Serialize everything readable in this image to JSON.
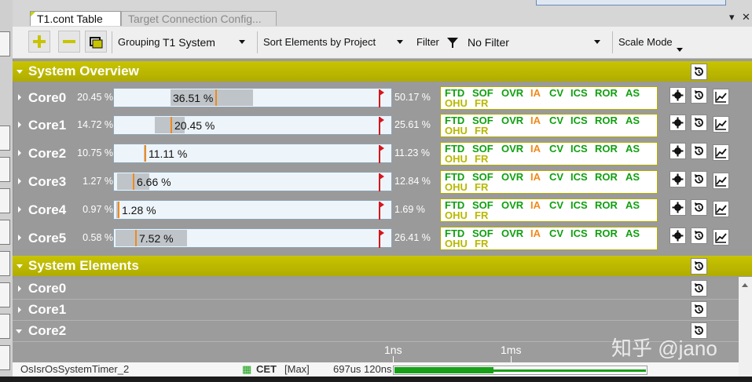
{
  "tabs": [
    {
      "label": "T1.cont Table",
      "active": true
    },
    {
      "label": "Target Connection Config...",
      "active": false
    }
  ],
  "toolbar": {
    "grouping_label": "Grouping",
    "grouping_value": "T1 System",
    "sort_value": "Sort Elements by Project",
    "filter_label": "Filter",
    "filter_value": "No Filter",
    "scale_mode_label": "Scale Mode"
  },
  "system_overview": {
    "title": "System Overview",
    "cores": [
      {
        "name": "Core0",
        "min": "20.45 %",
        "avg": 36.51,
        "avg_text": "36.51 %",
        "max": 50.17,
        "max_text": "50.17 %"
      },
      {
        "name": "Core1",
        "min": "14.72 %",
        "avg": 20.45,
        "avg_text": "20.45 %",
        "max": 25.61,
        "max_text": "25.61 %"
      },
      {
        "name": "Core2",
        "min": "10.75 %",
        "avg": 11.11,
        "avg_text": "11.11 %",
        "max": 11.23,
        "max_text": "11.23 %"
      },
      {
        "name": "Core3",
        "min": "1.27 %",
        "avg": 6.66,
        "avg_text": "6.66 %",
        "max": 12.84,
        "max_text": "12.84 %"
      },
      {
        "name": "Core4",
        "min": "0.97 %",
        "avg": 1.28,
        "avg_text": "1.28 %",
        "max": 1.69,
        "max_text": "1.69 %"
      },
      {
        "name": "Core5",
        "min": "0.58 %",
        "avg": 7.52,
        "avg_text": "7.52 %",
        "max": 26.41,
        "max_text": "26.41 %"
      }
    ],
    "flag_labels": [
      {
        "text": "FTD",
        "color": "green"
      },
      {
        "text": "SOF",
        "color": "green"
      },
      {
        "text": "OVR",
        "color": "green"
      },
      {
        "text": "IA",
        "color": "orange"
      },
      {
        "text": "CV",
        "color": "green"
      },
      {
        "text": "ICS",
        "color": "green"
      },
      {
        "text": "ROR",
        "color": "green"
      },
      {
        "text": "AS",
        "color": "green"
      },
      {
        "text": "OHU",
        "color": "yellow"
      },
      {
        "text": "FR",
        "color": "yellow"
      }
    ]
  },
  "system_elements": {
    "title": "System Elements",
    "items": [
      {
        "name": "Core0",
        "expanded": false
      },
      {
        "name": "Core1",
        "expanded": false
      },
      {
        "name": "Core2",
        "expanded": true
      }
    ]
  },
  "timeline": {
    "tick_1": "1ns",
    "tick_2": "1ms",
    "row_name": "OsIsrOsSystemTimer_2",
    "row_metric": "CET",
    "row_kind": "[Max]",
    "row_value": "697us 120ns"
  },
  "watermark": "知乎 @jano"
}
